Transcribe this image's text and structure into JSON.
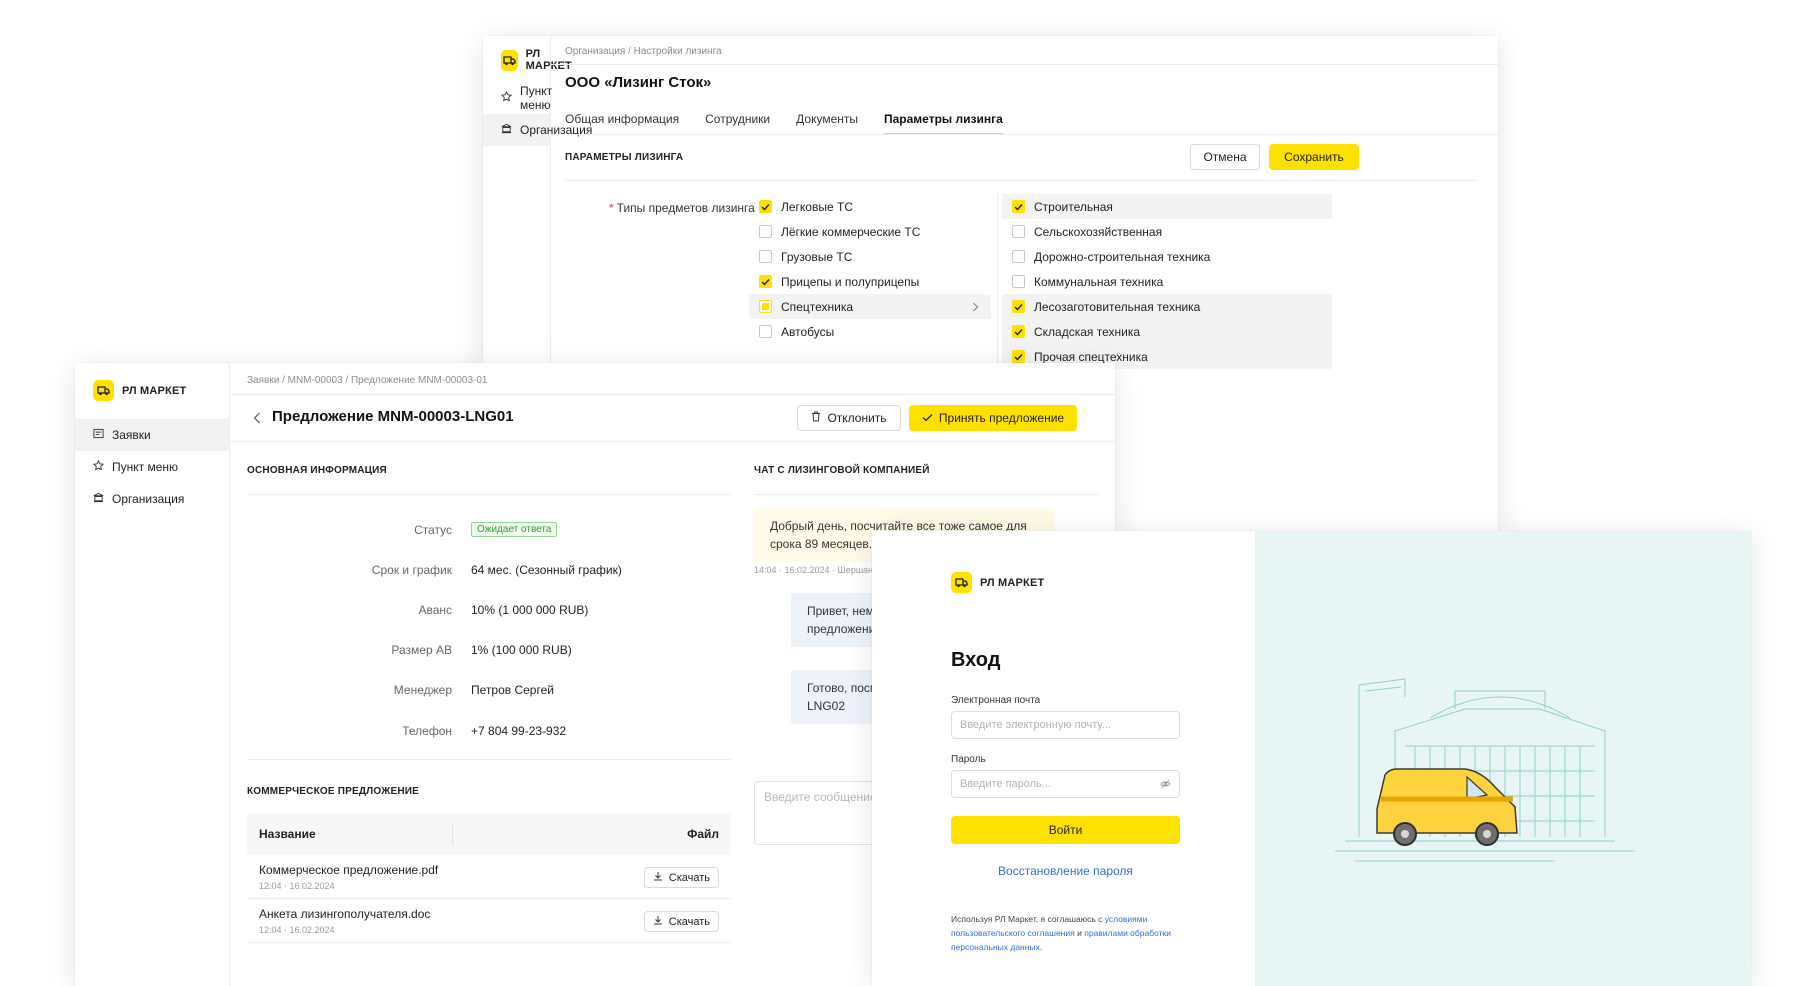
{
  "brand": {
    "name": "РЛ МАРКЕТ",
    "accent": "#ffe100"
  },
  "org_window": {
    "breadcrumb": "Организация / Настройки лизинга",
    "title": "ООО «Лизинг Сток»",
    "nav": [
      {
        "label": "Пункт меню",
        "icon": "star-icon"
      },
      {
        "label": "Организация",
        "icon": "bank-icon"
      }
    ],
    "tabs": [
      "Общая информация",
      "Сотрудники",
      "Документы",
      "Параметры лизинга"
    ],
    "section_title": "ПАРАМЕТРЫ ЛИЗИНГА",
    "cancel_label": "Отмена",
    "save_label": "Сохранить",
    "field_label": "Типы предметов лизинга",
    "left_options": [
      {
        "label": "Легковые ТС",
        "checked": true
      },
      {
        "label": "Лёгкие коммерческие ТС",
        "checked": false
      },
      {
        "label": "Грузовые ТС",
        "checked": false
      },
      {
        "label": "Прицепы и полуприцепы",
        "checked": true
      },
      {
        "label": "Спецтехника",
        "checked": "indeterminate"
      },
      {
        "label": "Автобусы",
        "checked": false
      }
    ],
    "right_options": [
      {
        "label": "Строительная",
        "checked": true
      },
      {
        "label": "Сельскохозяйственная",
        "checked": false
      },
      {
        "label": "Дорожно-строительная техника",
        "checked": false
      },
      {
        "label": "Коммунальная техника",
        "checked": false
      },
      {
        "label": "Лесозаготовительная техника",
        "checked": true
      },
      {
        "label": "Складская техника",
        "checked": true
      },
      {
        "label": "Прочая спецтехника",
        "checked": true
      }
    ]
  },
  "offer_window": {
    "breadcrumb": "Заявки / MNM-00003 / Предложение MNM-00003-01",
    "nav": [
      {
        "label": "Заявки",
        "icon": "list-icon"
      },
      {
        "label": "Пункт меню",
        "icon": "star-icon"
      },
      {
        "label": "Организация",
        "icon": "bank-icon"
      }
    ],
    "title": "Предложение MNM-00003-LNG01",
    "reject_label": "Отклонить",
    "accept_label": "Принять предложение",
    "main_section": "ОСНОВНАЯ ИНФОРМАЦИЯ",
    "info": {
      "status_label": "Статус",
      "status_value": "Ожидает ответа",
      "term_label": "Срок и график",
      "term_value": "64 мес. (Сезонный график)",
      "advance_label": "Аванс",
      "advance_value": "10% (1 000 000 RUB)",
      "ab_label": "Размер АВ",
      "ab_value": "1% (100 000 RUB)",
      "manager_label": "Менеджер",
      "manager_value": "Петров Сергей",
      "phone_label": "Телефон",
      "phone_value": "+7 804 99-23-932"
    },
    "commercial_section": "КОММЕРЧЕСКОЕ ПРЕДЛОЖЕНИЕ",
    "table": {
      "col_name": "Название",
      "col_file": "Файл",
      "download_label": "Скачать",
      "rows": [
        {
          "name": "Коммерческое предложение.pdf",
          "date": "12:04 · 16.02.2024"
        },
        {
          "name": "Анкета лизингополучателя.doc",
          "date": "12:04 · 16.02.2024"
        }
      ]
    },
    "chat_section": "ЧАТ С ЛИЗИНГОВОЙ КОМПАНИЕЙ",
    "messages": [
      {
        "text1": "Добрый день, посчитайте все тоже самое для",
        "text2": "срока 89 месяцев."
      },
      {
        "text1": "Привет, немно",
        "text2": "предложение"
      },
      {
        "text1": "Готово, посмот",
        "text2": "LNG02"
      }
    ],
    "msg_meta": "14:04 · 16.02.2024 · Шершан",
    "chat_placeholder": "Введите сообщение..."
  },
  "login_window": {
    "heading": "Вход",
    "email_label": "Электронная почта",
    "email_placeholder": "Введите электронную почту...",
    "password_label": "Пароль",
    "password_placeholder": "Введите пароль...",
    "login_label": "Войти",
    "restore_label": "Восстановление пароля",
    "legal_prefix": "Используя РЛ Маркет, я соглашаюсь с",
    "legal_link1": "условиями пользовательского соглашения",
    "legal_and": "и",
    "legal_link2": "правилами обработки персональных данных",
    "legal_suffix": "."
  }
}
